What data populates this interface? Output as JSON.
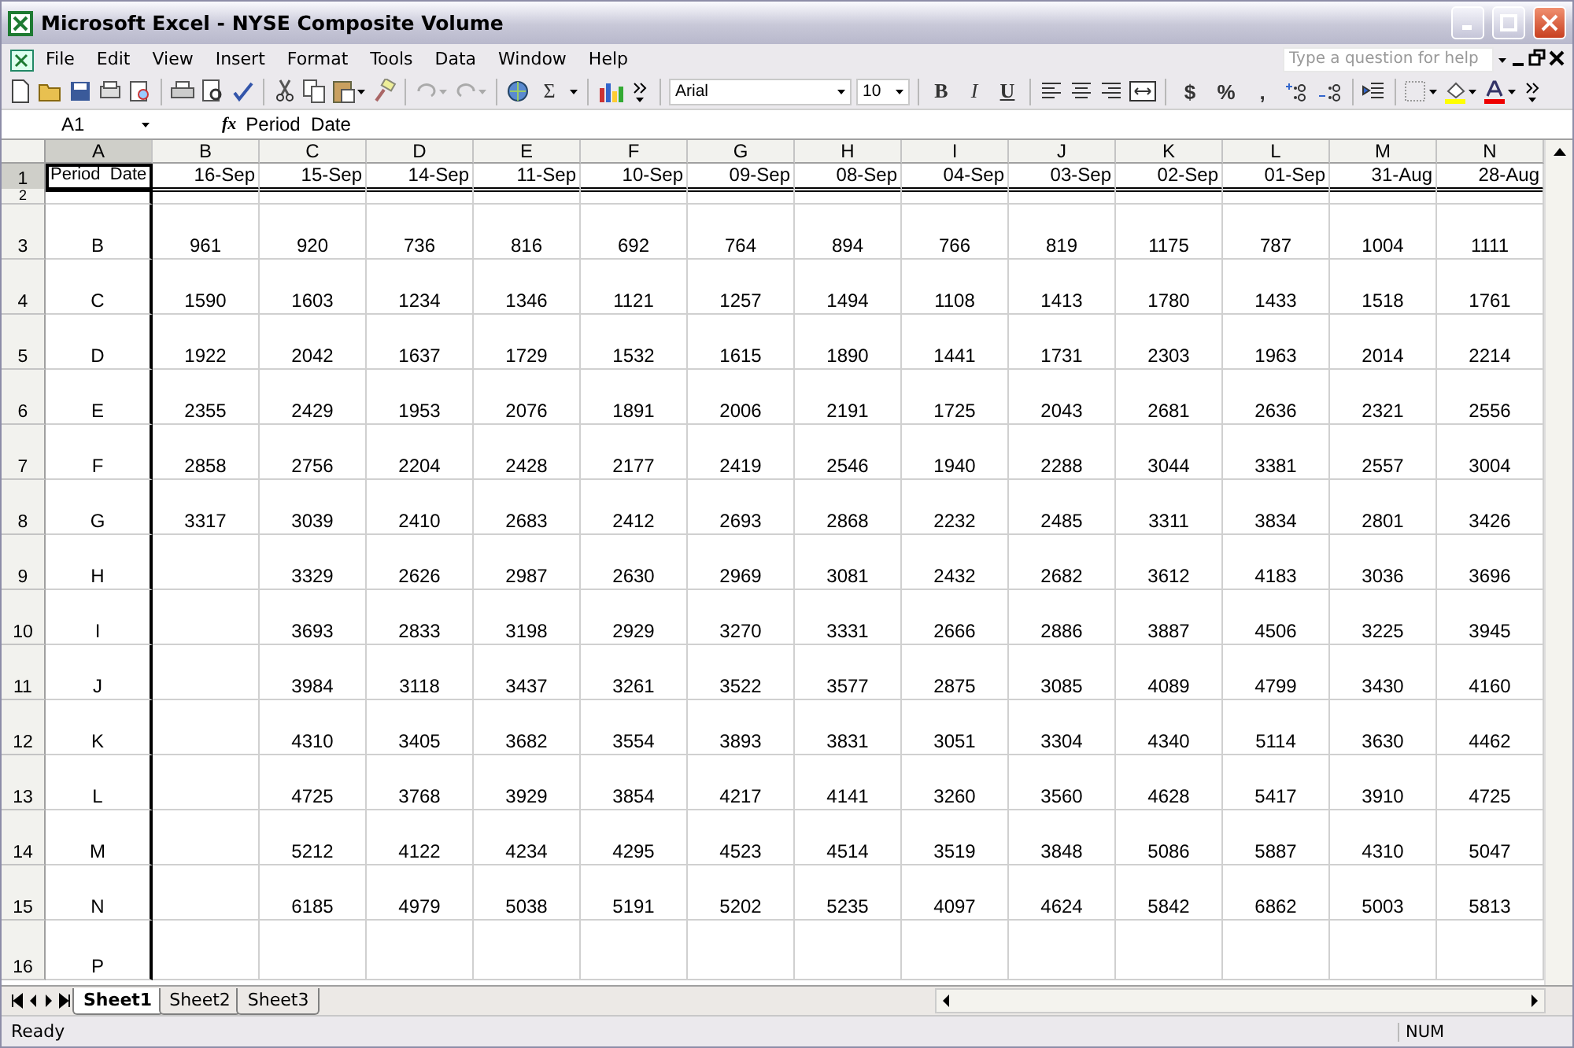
{
  "window": {
    "title": "Microsoft Excel - NYSE Composite Volume"
  },
  "menus": [
    "File",
    "Edit",
    "View",
    "Insert",
    "Format",
    "Tools",
    "Data",
    "Window",
    "Help"
  ],
  "help_box": {
    "placeholder": "Type a question for help"
  },
  "toolbar": {
    "autosum": "Σ",
    "font": "Arial",
    "font_size": "10",
    "format_buttons": [
      "B",
      "I",
      "U"
    ],
    "number_buttons": [
      "$",
      "%",
      ","
    ]
  },
  "formula_bar": {
    "name_box": "A1",
    "fx": "fx",
    "formula": "Period  Date"
  },
  "columns": [
    {
      "label": "A",
      "selected": true
    },
    {
      "label": "B",
      "selected": false
    },
    {
      "label": "C",
      "selected": false
    },
    {
      "label": "D",
      "selected": false
    },
    {
      "label": "E",
      "selected": false
    },
    {
      "label": "F",
      "selected": false
    },
    {
      "label": "G",
      "selected": false
    },
    {
      "label": "H",
      "selected": false
    },
    {
      "label": "I",
      "selected": false
    },
    {
      "label": "J",
      "selected": false
    },
    {
      "label": "K",
      "selected": false
    },
    {
      "label": "L",
      "selected": false
    },
    {
      "label": "M",
      "selected": false
    },
    {
      "label": "N",
      "selected": false
    }
  ],
  "rows": [
    {
      "header": "1",
      "selected": true,
      "kind": "labels",
      "cells": [
        "Period  Date",
        "16-Sep",
        "15-Sep",
        "14-Sep",
        "11-Sep",
        "10-Sep",
        "09-Sep",
        "08-Sep",
        "04-Sep",
        "03-Sep",
        "02-Sep",
        "01-Sep",
        "31-Aug",
        "28-Aug"
      ]
    },
    {
      "header": "2",
      "selected": false,
      "kind": "spacer"
    },
    {
      "header": "3",
      "selected": false,
      "kind": "data",
      "cells": [
        "B",
        "961",
        "920",
        "736",
        "816",
        "692",
        "764",
        "894",
        "766",
        "819",
        "1175",
        "787",
        "1004",
        "1111"
      ]
    },
    {
      "header": "4",
      "selected": false,
      "kind": "data",
      "cells": [
        "C",
        "1590",
        "1603",
        "1234",
        "1346",
        "1121",
        "1257",
        "1494",
        "1108",
        "1413",
        "1780",
        "1433",
        "1518",
        "1761"
      ]
    },
    {
      "header": "5",
      "selected": false,
      "kind": "data",
      "cells": [
        "D",
        "1922",
        "2042",
        "1637",
        "1729",
        "1532",
        "1615",
        "1890",
        "1441",
        "1731",
        "2303",
        "1963",
        "2014",
        "2214"
      ]
    },
    {
      "header": "6",
      "selected": false,
      "kind": "data",
      "cells": [
        "E",
        "2355",
        "2429",
        "1953",
        "2076",
        "1891",
        "2006",
        "2191",
        "1725",
        "2043",
        "2681",
        "2636",
        "2321",
        "2556"
      ]
    },
    {
      "header": "7",
      "selected": false,
      "kind": "data",
      "cells": [
        "F",
        "2858",
        "2756",
        "2204",
        "2428",
        "2177",
        "2419",
        "2546",
        "1940",
        "2288",
        "3044",
        "3381",
        "2557",
        "3004"
      ]
    },
    {
      "header": "8",
      "selected": false,
      "kind": "data",
      "cells": [
        "G",
        "3317",
        "3039",
        "2410",
        "2683",
        "2412",
        "2693",
        "2868",
        "2232",
        "2485",
        "3311",
        "3834",
        "2801",
        "3426"
      ]
    },
    {
      "header": "9",
      "selected": false,
      "kind": "data",
      "cells": [
        "H",
        null,
        "3329",
        "2626",
        "2987",
        "2630",
        "2969",
        "3081",
        "2432",
        "2682",
        "3612",
        "4183",
        "3036",
        "3696"
      ]
    },
    {
      "header": "10",
      "selected": false,
      "kind": "data",
      "cells": [
        "I",
        null,
        "3693",
        "2833",
        "3198",
        "2929",
        "3270",
        "3331",
        "2666",
        "2886",
        "3887",
        "4506",
        "3225",
        "3945"
      ]
    },
    {
      "header": "11",
      "selected": false,
      "kind": "data",
      "cells": [
        "J",
        null,
        "3984",
        "3118",
        "3437",
        "3261",
        "3522",
        "3577",
        "2875",
        "3085",
        "4089",
        "4799",
        "3430",
        "4160"
      ]
    },
    {
      "header": "12",
      "selected": false,
      "kind": "data",
      "cells": [
        "K",
        null,
        "4310",
        "3405",
        "3682",
        "3554",
        "3893",
        "3831",
        "3051",
        "3304",
        "4340",
        "5114",
        "3630",
        "4462"
      ]
    },
    {
      "header": "13",
      "selected": false,
      "kind": "data",
      "cells": [
        "L",
        null,
        "4725",
        "3768",
        "3929",
        "3854",
        "4217",
        "4141",
        "3260",
        "3560",
        "4628",
        "5417",
        "3910",
        "4725"
      ]
    },
    {
      "header": "14",
      "selected": false,
      "kind": "data",
      "cells": [
        "M",
        null,
        "5212",
        "4122",
        "4234",
        "4295",
        "4523",
        "4514",
        "3519",
        "3848",
        "5086",
        "5887",
        "4310",
        "5047"
      ]
    },
    {
      "header": "15",
      "selected": false,
      "kind": "data",
      "cells": [
        "N",
        null,
        "6185",
        "4979",
        "5038",
        "5191",
        "5202",
        "5235",
        "4097",
        "4624",
        "5842",
        "6862",
        "5003",
        "5813"
      ]
    },
    {
      "header": "16",
      "selected": false,
      "kind": "data",
      "cells": [
        "P"
      ]
    }
  ],
  "sheet_tabs": [
    {
      "label": "Sheet1",
      "selected": true
    },
    {
      "label": "Sheet2",
      "selected": false
    },
    {
      "label": "Sheet3",
      "selected": false
    }
  ],
  "status_bar": {
    "status": "Ready",
    "num_lock": "NUM"
  }
}
